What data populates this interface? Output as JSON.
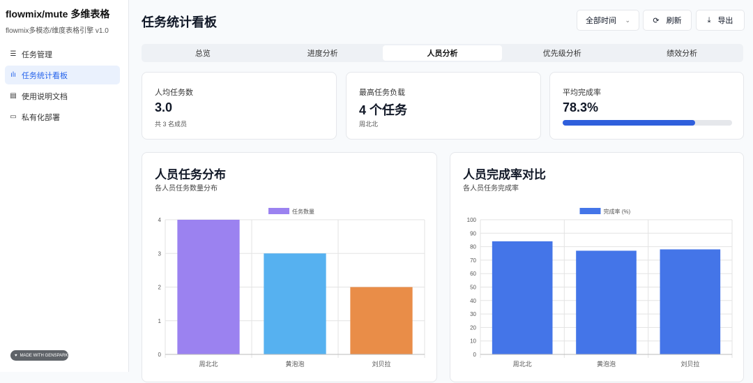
{
  "sidebar": {
    "brand": "flowmix/mute 多维表格",
    "subtitle": "flowmix多模态/维度表格引擎 v1.0",
    "items": [
      {
        "label": "任务管理",
        "icon": "database-icon"
      },
      {
        "label": "任务统计看板",
        "icon": "bar-chart-icon",
        "active": true
      },
      {
        "label": "使用说明文档",
        "icon": "document-icon"
      },
      {
        "label": "私有化部署",
        "icon": "server-icon"
      }
    ],
    "badge": "MADE WITH GENSPARK"
  },
  "header": {
    "title": "任务统计看板",
    "time_filter": "全部时间",
    "refresh": "刷新",
    "export": "导出"
  },
  "tabs": [
    "总览",
    "进度分析",
    "人员分析",
    "优先级分析",
    "绩效分析"
  ],
  "active_tab": 2,
  "stats": [
    {
      "label": "人均任务数",
      "value": "3.0",
      "note": "共 3 名成员"
    },
    {
      "label": "最高任务负载",
      "value": "4 个任务",
      "note": "周北北"
    },
    {
      "label": "平均完成率",
      "value": "78.3%",
      "progress": 78.3
    }
  ],
  "chart_data": [
    {
      "type": "bar",
      "title": "人员任务分布",
      "subtitle": "各人员任务数量分布",
      "legend": "任务数量",
      "categories": [
        "周北北",
        "黄泡泡",
        "刘贝拉"
      ],
      "values": [
        4,
        3,
        2
      ],
      "colors": [
        "#9b82f0",
        "#56b1f0",
        "#e98d48"
      ],
      "ylim": [
        0,
        4
      ],
      "yticks": [
        0,
        1,
        2,
        3,
        4
      ],
      "legend_color": "#9b82f0"
    },
    {
      "type": "bar",
      "title": "人员完成率对比",
      "subtitle": "各人员任务完成率",
      "legend": "完成率 (%)",
      "categories": [
        "周北北",
        "黄泡泡",
        "刘贝拉"
      ],
      "values": [
        84,
        77,
        78
      ],
      "colors": [
        "#4475e8",
        "#4475e8",
        "#4475e8"
      ],
      "ylim": [
        0,
        100
      ],
      "yticks": [
        0,
        10,
        20,
        30,
        40,
        50,
        60,
        70,
        80,
        90,
        100
      ],
      "legend_color": "#4475e8"
    }
  ]
}
